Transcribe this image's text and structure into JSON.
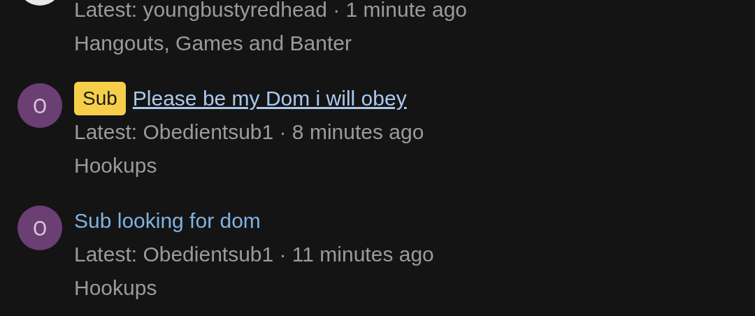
{
  "threads": [
    {
      "color": "#e8e8e8",
      "latest": "Latest: youngbustyredhead · 1 minute ago",
      "forum": "Hangouts, Games and Banter"
    },
    {
      "color": "#6b3f73",
      "avatar_letter": "O",
      "badge": "Sub",
      "title": "Please be my Dom i will obey",
      "underlined": true,
      "latest": "Latest: Obedientsub1 · 8 minutes ago",
      "forum": "Hookups"
    },
    {
      "color": "#6b3f73",
      "avatar_letter": "O",
      "title": "Sub looking for dom",
      "underlined": false,
      "latest": "Latest: Obedientsub1 · 11 minutes ago",
      "forum": "Hookups"
    }
  ]
}
